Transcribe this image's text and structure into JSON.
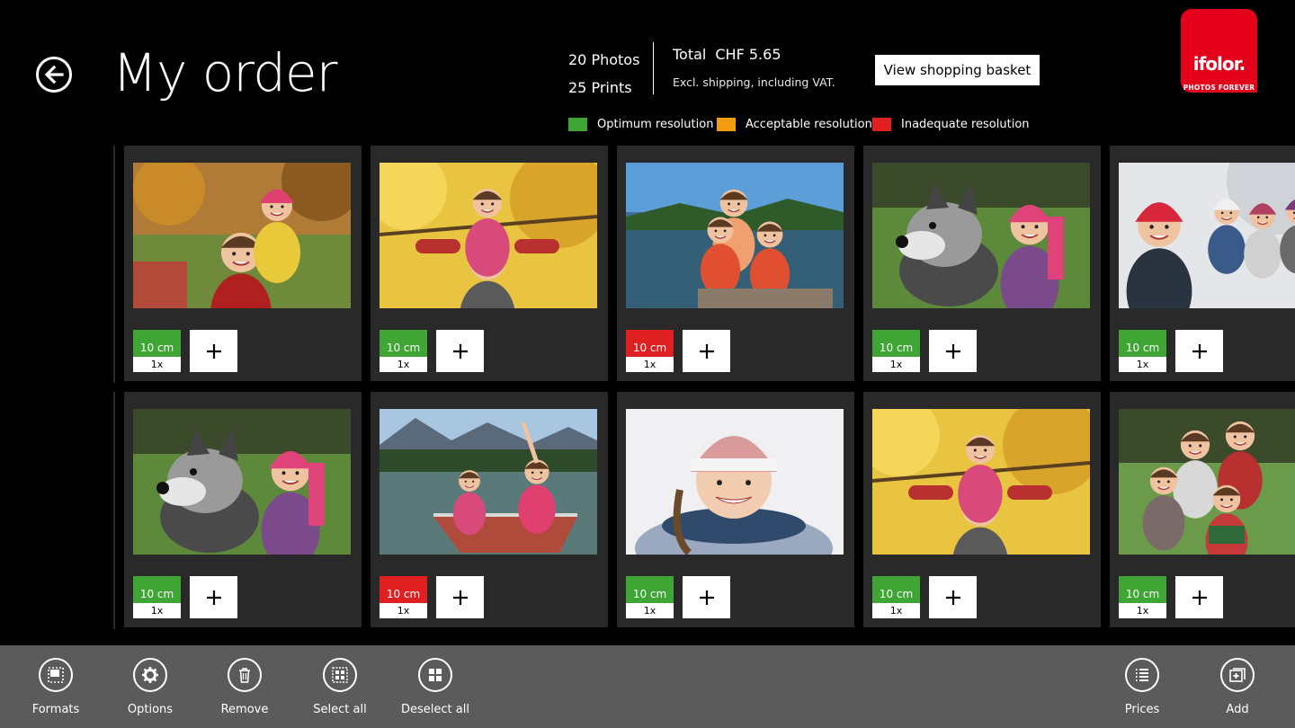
{
  "header": {
    "title": "My order",
    "photos_count": "20 Photos",
    "prints_count": "25 Prints",
    "total_label": "Total",
    "total_amount": "CHF 5.65",
    "total_note": "Excl. shipping, including VAT.",
    "basket_button": "View shopping basket",
    "logo": {
      "brand": "ifolor.",
      "tagline": "PHOTOS FOREVER"
    }
  },
  "legend": [
    {
      "label": "Optimum resolution",
      "color": "#3fa535"
    },
    {
      "label": "Acceptable resolution",
      "color": "#f39c12"
    },
    {
      "label": "Inadequate resolution",
      "color": "#e02020"
    }
  ],
  "prints": [
    {
      "scene": "man-child-autumn",
      "size": "10 cm",
      "qty": "1x",
      "status": "optimum"
    },
    {
      "scene": "shoulders-yellow-tree",
      "size": "10 cm",
      "qty": "1x",
      "status": "optimum"
    },
    {
      "scene": "family-lake-lifejackets",
      "size": "10 cm",
      "qty": "1x",
      "status": "inadequate"
    },
    {
      "scene": "girl-with-dog",
      "size": "10 cm",
      "qty": "1x",
      "status": "optimum"
    },
    {
      "scene": "kids-snow",
      "size": "10 cm",
      "qty": "1x",
      "status": "optimum"
    },
    {
      "scene": "girl-with-dog",
      "size": "10 cm",
      "qty": "1x",
      "status": "optimum"
    },
    {
      "scene": "boat-lake-mountains",
      "size": "10 cm",
      "qty": "1x",
      "status": "inadequate"
    },
    {
      "scene": "girl-winter-hat",
      "size": "10 cm",
      "qty": "1x",
      "status": "optimum"
    },
    {
      "scene": "shoulders-yellow-tree",
      "size": "10 cm",
      "qty": "1x",
      "status": "optimum"
    },
    {
      "scene": "family-park",
      "size": "10 cm",
      "qty": "1x",
      "status": "optimum"
    }
  ],
  "status_colors": {
    "optimum": "#3fa535",
    "acceptable": "#f39c12",
    "inadequate": "#e02020"
  },
  "appbar": {
    "left": [
      {
        "label": "Formats",
        "icon": "formats-icon"
      },
      {
        "label": "Options",
        "icon": "gear-icon"
      },
      {
        "label": "Remove",
        "icon": "trash-icon"
      },
      {
        "label": "Select all",
        "icon": "select-all-icon"
      },
      {
        "label": "Deselect all",
        "icon": "deselect-all-icon"
      }
    ],
    "right": [
      {
        "label": "Prices",
        "icon": "list-icon"
      },
      {
        "label": "Add",
        "icon": "add-photo-icon"
      }
    ]
  }
}
